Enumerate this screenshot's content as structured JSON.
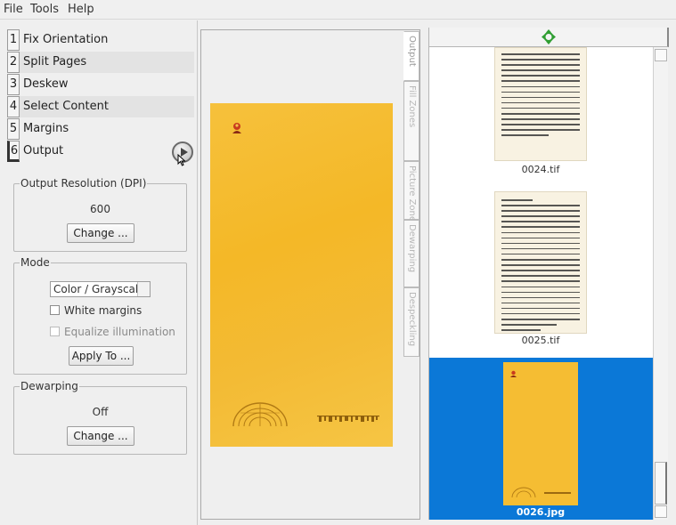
{
  "menu": {
    "file": "File",
    "tools": "Tools",
    "help": "Help"
  },
  "stages": [
    {
      "num": "1",
      "label": "Fix Orientation"
    },
    {
      "num": "2",
      "label": "Split Pages"
    },
    {
      "num": "3",
      "label": "Deskew"
    },
    {
      "num": "4",
      "label": "Select Content"
    },
    {
      "num": "5",
      "label": "Margins"
    },
    {
      "num": "6",
      "label": "Output"
    }
  ],
  "output_resolution": {
    "title": "Output Resolution (DPI)",
    "value": "600",
    "change_label": "Change ..."
  },
  "mode": {
    "title": "Mode",
    "selected": "Color / Grayscale",
    "white_margins": "White margins",
    "equalize_illumination": "Equalize illumination",
    "apply_label": "Apply To ..."
  },
  "dewarping": {
    "title": "Dewarping",
    "value": "Off",
    "change_label": "Change ..."
  },
  "view_tabs": [
    {
      "label": "Output"
    },
    {
      "label": "Fill Zones"
    },
    {
      "label": "Picture Zones"
    },
    {
      "label": "Dewarping"
    },
    {
      "label": "Despeckling"
    }
  ],
  "thumbnails": [
    {
      "name": "0024.tif"
    },
    {
      "name": "0025.tif"
    },
    {
      "name": "0026.jpg"
    }
  ],
  "colors": {
    "selection": "#0b78d7",
    "cover": "#f4b827"
  },
  "icons": {
    "stage_run": "play-icon",
    "thumb_header": "green-move-icon"
  }
}
